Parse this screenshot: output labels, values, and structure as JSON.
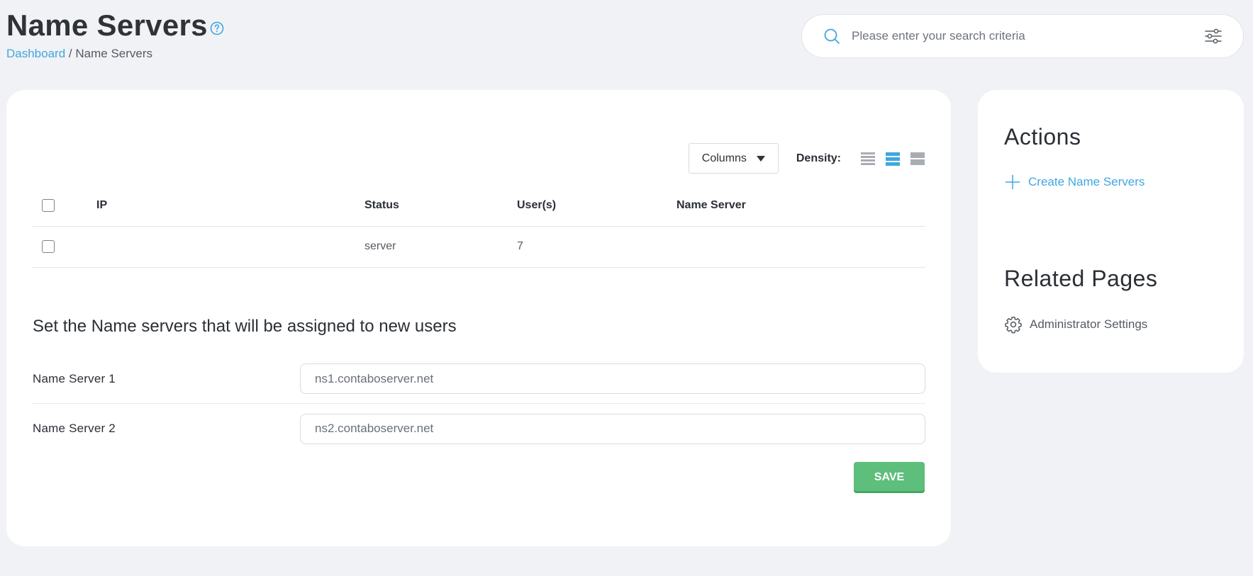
{
  "header": {
    "title": "Name Servers",
    "breadcrumb": {
      "home": "Dashboard",
      "separator": "/",
      "current": "Name Servers"
    }
  },
  "search": {
    "placeholder": "Please enter your search criteria"
  },
  "toolbar": {
    "columns_label": "Columns",
    "density_label": "Density:",
    "density_selected": "normal"
  },
  "table": {
    "headers": [
      "IP",
      "Status",
      "User(s)",
      "Name Server"
    ],
    "rows": [
      {
        "ip": "",
        "status": "server",
        "users": "7",
        "name_server": ""
      }
    ]
  },
  "form": {
    "section_title": "Set the Name servers that will be assigned to new users",
    "ns1": {
      "label": "Name Server 1",
      "value": "ns1.contaboserver.net"
    },
    "ns2": {
      "label": "Name Server 2",
      "value": "ns2.contaboserver.net"
    },
    "save_label": "SAVE"
  },
  "sidebar": {
    "actions_heading": "Actions",
    "create_link": "Create Name Servers",
    "related_heading": "Related Pages",
    "related_link": "Administrator Settings"
  },
  "colors": {
    "accent": "#3fa7e0",
    "save": "#5ebe7c",
    "background": "#f1f2f6"
  },
  "icons": [
    "help-icon",
    "search-icon",
    "filter-sliders-icon",
    "caret-down-icon",
    "density-compact-icon",
    "density-normal-icon",
    "density-comfortable-icon",
    "plus-icon",
    "gear-icon"
  ]
}
